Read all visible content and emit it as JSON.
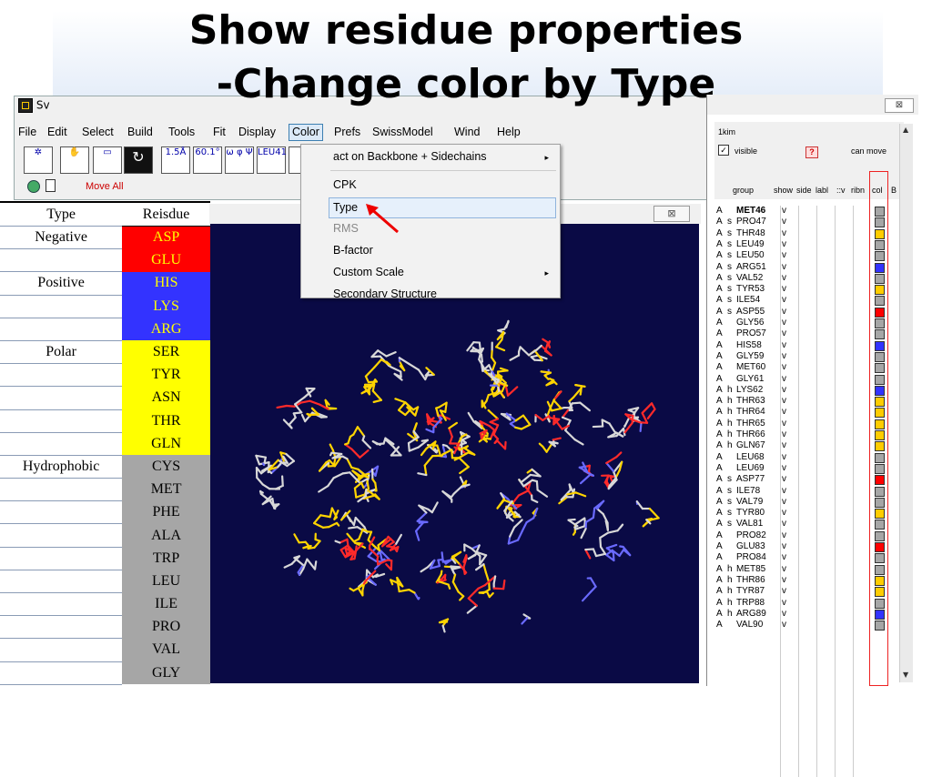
{
  "slide": {
    "title_line1": "Show residue properties",
    "title_line2": "-Change color by Type"
  },
  "app": {
    "title_fragment": "Sv",
    "menus": [
      "File",
      "Edit",
      "Select",
      "Build",
      "Tools",
      "Fit",
      "Display",
      "Color",
      "Prefs",
      "SwissModel",
      "Wind",
      "Help"
    ],
    "open_menu": "Color",
    "toolbar_labels": [
      "1.5Å",
      "60.1°",
      "ω φ Ψ",
      "LEU41",
      "?"
    ],
    "move_all": "Move All"
  },
  "color_menu": {
    "items": [
      {
        "label": "act on Backbone + Sidechains",
        "submenu": true,
        "enabled": true
      },
      {
        "label": "CPK",
        "submenu": false,
        "enabled": true
      },
      {
        "label": "Type",
        "submenu": false,
        "enabled": true,
        "highlighted": true
      },
      {
        "label": "RMS",
        "submenu": false,
        "enabled": false
      },
      {
        "label": "B-factor",
        "submenu": false,
        "enabled": true
      },
      {
        "label": "Custom Scale",
        "submenu": true,
        "enabled": true
      },
      {
        "label": "Secondary Structure",
        "submenu": false,
        "enabled": true
      }
    ],
    "submenu_arrow": "▸"
  },
  "viewer": {
    "close_label": "⊠",
    "background": "#0a0a45"
  },
  "residue_table": {
    "headers": [
      "Type",
      "Reisdue"
    ],
    "groups": [
      {
        "type": "Negative",
        "color": "#ff0000",
        "residues": [
          "ASP",
          "GLU"
        ]
      },
      {
        "type": "Positive",
        "color": "#3333ff",
        "residues": [
          "HIS",
          "LYS",
          "ARG"
        ]
      },
      {
        "type": "Polar",
        "color": "#ffff00",
        "residues": [
          "SER",
          "TYR",
          "ASN",
          "THR",
          "GLN"
        ]
      },
      {
        "type": "Hydrophobic",
        "color": "#a6a6a6",
        "residues": [
          "CYS",
          "MET",
          "PHE",
          "ALA",
          "TRP",
          "LEU",
          "ILE",
          "PRO",
          "VAL",
          "GLY"
        ]
      }
    ]
  },
  "sequence_panel": {
    "close_label": "⊠",
    "name": "1kim",
    "visible_label": "visible",
    "visible_checked": "✓",
    "question": "?",
    "can_move_label": "can move",
    "column_headers": [
      "group",
      "show",
      "side",
      "labl",
      "::v",
      "ribn",
      "col",
      "B"
    ],
    "rows": [
      {
        "chain": "A",
        "ss": "",
        "res": "MET46",
        "vis": "v",
        "color": "#a6a6a6"
      },
      {
        "chain": "A",
        "ss": "s",
        "res": "PRO47",
        "vis": "v",
        "color": "#a6a6a6"
      },
      {
        "chain": "A",
        "ss": "s",
        "res": "THR48",
        "vis": "v",
        "color": "#ffcc00"
      },
      {
        "chain": "A",
        "ss": "s",
        "res": "LEU49",
        "vis": "v",
        "color": "#a6a6a6"
      },
      {
        "chain": "A",
        "ss": "s",
        "res": "LEU50",
        "vis": "v",
        "color": "#a6a6a6"
      },
      {
        "chain": "A",
        "ss": "s",
        "res": "ARG51",
        "vis": "v",
        "color": "#3333ff"
      },
      {
        "chain": "A",
        "ss": "s",
        "res": "VAL52",
        "vis": "v",
        "color": "#a6a6a6"
      },
      {
        "chain": "A",
        "ss": "s",
        "res": "TYR53",
        "vis": "v",
        "color": "#ffcc00"
      },
      {
        "chain": "A",
        "ss": "s",
        "res": "ILE54",
        "vis": "v",
        "color": "#a6a6a6"
      },
      {
        "chain": "A",
        "ss": "s",
        "res": "ASP55",
        "vis": "v",
        "color": "#ff0000"
      },
      {
        "chain": "A",
        "ss": "",
        "res": "GLY56",
        "vis": "v",
        "color": "#a6a6a6"
      },
      {
        "chain": "A",
        "ss": "",
        "res": "PRO57",
        "vis": "v",
        "color": "#a6a6a6"
      },
      {
        "chain": "A",
        "ss": "",
        "res": "HIS58",
        "vis": "v",
        "color": "#3333ff"
      },
      {
        "chain": "A",
        "ss": "",
        "res": "GLY59",
        "vis": "v",
        "color": "#a6a6a6"
      },
      {
        "chain": "A",
        "ss": "",
        "res": "MET60",
        "vis": "v",
        "color": "#a6a6a6"
      },
      {
        "chain": "A",
        "ss": "",
        "res": "GLY61",
        "vis": "v",
        "color": "#a6a6a6"
      },
      {
        "chain": "A",
        "ss": "h",
        "res": "LYS62",
        "vis": "v",
        "color": "#3333ff"
      },
      {
        "chain": "A",
        "ss": "h",
        "res": "THR63",
        "vis": "v",
        "color": "#ffcc00"
      },
      {
        "chain": "A",
        "ss": "h",
        "res": "THR64",
        "vis": "v",
        "color": "#ffcc00"
      },
      {
        "chain": "A",
        "ss": "h",
        "res": "THR65",
        "vis": "v",
        "color": "#ffcc00"
      },
      {
        "chain": "A",
        "ss": "h",
        "res": "THR66",
        "vis": "v",
        "color": "#ffcc00"
      },
      {
        "chain": "A",
        "ss": "h",
        "res": "GLN67",
        "vis": "v",
        "color": "#ffcc00"
      },
      {
        "chain": "A",
        "ss": "",
        "res": "LEU68",
        "vis": "v",
        "color": "#a6a6a6"
      },
      {
        "chain": "A",
        "ss": "",
        "res": "LEU69",
        "vis": "v",
        "color": "#a6a6a6"
      },
      {
        "chain": "A",
        "ss": "s",
        "res": "ASP77",
        "vis": "v",
        "color": "#ff0000"
      },
      {
        "chain": "A",
        "ss": "s",
        "res": "ILE78",
        "vis": "v",
        "color": "#a6a6a6"
      },
      {
        "chain": "A",
        "ss": "s",
        "res": "VAL79",
        "vis": "v",
        "color": "#a6a6a6"
      },
      {
        "chain": "A",
        "ss": "s",
        "res": "TYR80",
        "vis": "v",
        "color": "#ffcc00"
      },
      {
        "chain": "A",
        "ss": "s",
        "res": "VAL81",
        "vis": "v",
        "color": "#a6a6a6"
      },
      {
        "chain": "A",
        "ss": "",
        "res": "PRO82",
        "vis": "v",
        "color": "#a6a6a6"
      },
      {
        "chain": "A",
        "ss": "",
        "res": "GLU83",
        "vis": "v",
        "color": "#ff0000"
      },
      {
        "chain": "A",
        "ss": "",
        "res": "PRO84",
        "vis": "v",
        "color": "#a6a6a6"
      },
      {
        "chain": "A",
        "ss": "h",
        "res": "MET85",
        "vis": "v",
        "color": "#a6a6a6"
      },
      {
        "chain": "A",
        "ss": "h",
        "res": "THR86",
        "vis": "v",
        "color": "#ffcc00"
      },
      {
        "chain": "A",
        "ss": "h",
        "res": "TYR87",
        "vis": "v",
        "color": "#ffcc00"
      },
      {
        "chain": "A",
        "ss": "h",
        "res": "TRP88",
        "vis": "v",
        "color": "#a6a6a6"
      },
      {
        "chain": "A",
        "ss": "h",
        "res": "ARG89",
        "vis": "v",
        "color": "#3333ff"
      },
      {
        "chain": "A",
        "ss": "",
        "res": "VAL90",
        "vis": "v",
        "color": "#a6a6a6"
      }
    ]
  }
}
